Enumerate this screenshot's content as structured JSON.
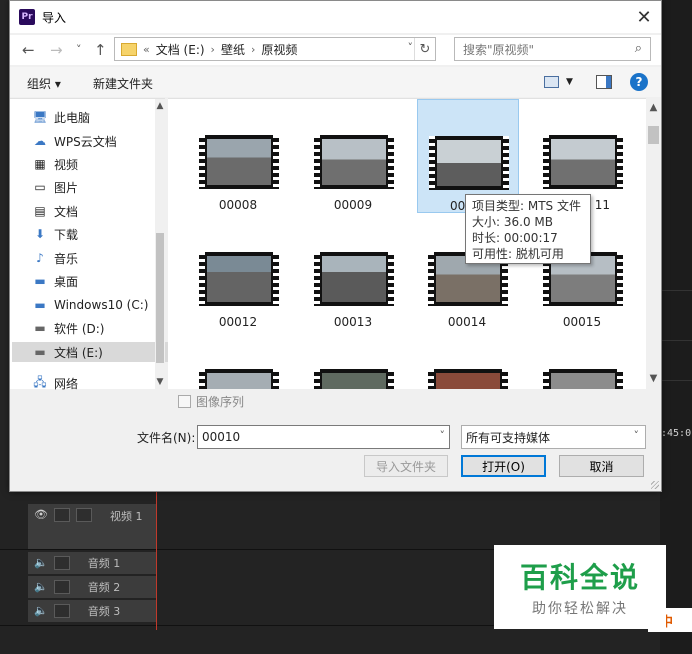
{
  "dialog": {
    "title": "导入",
    "app_icon_text": "Pr",
    "close_glyph": "✕"
  },
  "nav": {
    "back": "←",
    "forward": "→",
    "recent": "˅",
    "up": "↑",
    "breadcrumb_prefix": "«",
    "breadcrumbs": [
      "文档 (E:)",
      "壁纸",
      "原视频"
    ],
    "refresh": "↻",
    "search_placeholder": "搜索\"原视频\""
  },
  "toolbar": {
    "organize": "组织 ▾",
    "new_folder": "新建文件夹",
    "help": "?"
  },
  "sidebar": {
    "items": [
      {
        "label": "此电脑",
        "icon": "computer-icon"
      },
      {
        "label": "WPS云文档",
        "icon": "cloud-icon"
      },
      {
        "label": "视频",
        "icon": "video-icon"
      },
      {
        "label": "图片",
        "icon": "pictures-icon"
      },
      {
        "label": "文档",
        "icon": "documents-icon"
      },
      {
        "label": "下载",
        "icon": "download-icon"
      },
      {
        "label": "音乐",
        "icon": "music-icon"
      },
      {
        "label": "桌面",
        "icon": "desktop-icon"
      },
      {
        "label": "Windows10 (C:)",
        "icon": "drive-icon"
      },
      {
        "label": "软件 (D:)",
        "icon": "drive-icon"
      },
      {
        "label": "文档 (E:)",
        "icon": "drive-icon"
      },
      {
        "label": "网络",
        "icon": "network-icon"
      }
    ],
    "selected": "文档 (E:)"
  },
  "files": [
    {
      "name": "00008"
    },
    {
      "name": "00009"
    },
    {
      "name": "00010"
    },
    {
      "name": "00011"
    },
    {
      "name": "00012"
    },
    {
      "name": "00013"
    },
    {
      "name": "00014"
    },
    {
      "name": "00015"
    },
    {
      "name": ""
    },
    {
      "name": ""
    },
    {
      "name": ""
    },
    {
      "name": ""
    }
  ],
  "tile_labels": {
    "t3": "00",
    "t4": "11"
  },
  "tooltip": {
    "type": "项目类型: MTS 文件",
    "size": "大小: 36.0 MB",
    "duration": "时长: 00:00:17",
    "availability": "可用性: 脱机可用"
  },
  "footer": {
    "image_sequence": "图像序列",
    "filename_label": "文件名(N):",
    "filename_value": "00010",
    "filter_value": "所有可支持媒体",
    "import_folder": "导入文件夹",
    "open": "打开(O)",
    "cancel": "取消"
  },
  "background": {
    "timecode": ":45:0",
    "tracks": [
      "视频 1",
      "音频 1",
      "音频 2",
      "音频 3"
    ],
    "corner_text": "中"
  },
  "watermark": {
    "title": "百科全说",
    "subtitle": "助你轻松解决"
  },
  "colors": {
    "accent": "#0078d7",
    "selection": "#cce4f7",
    "watermark_green": "#1e9e4a"
  }
}
